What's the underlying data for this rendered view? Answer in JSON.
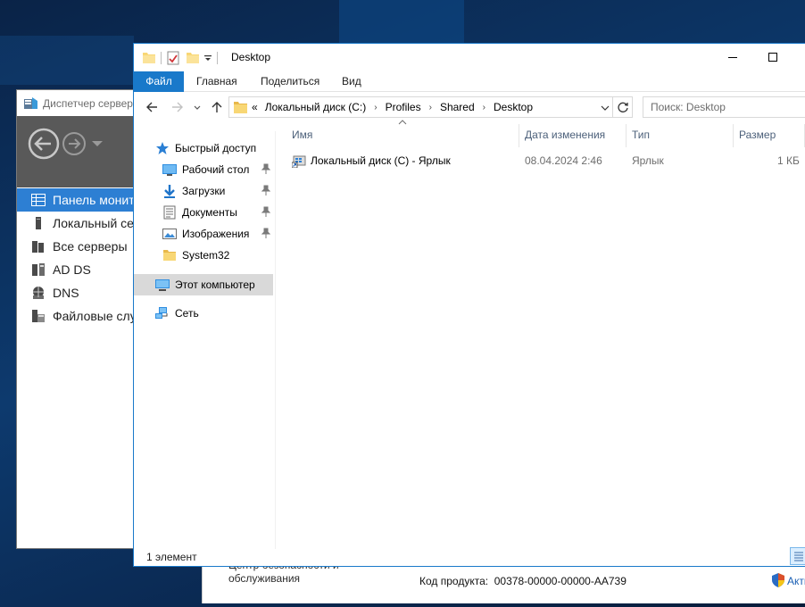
{
  "bottom_panel": {
    "security_link_line1": "Центр безопасности и",
    "security_link_line2": "обслуживания",
    "product_key_label": "Код продукта:",
    "product_key_value": "00378-00000-00000-AA739",
    "activate_text": "Акти"
  },
  "server_manager": {
    "title": "Диспетчер сервера",
    "items": [
      {
        "label": "Панель мониторинга",
        "icon": "dashboard-icon",
        "active": true
      },
      {
        "label": "Локальный сервер",
        "icon": "local-server-icon"
      },
      {
        "label": "Все серверы",
        "icon": "all-servers-icon"
      },
      {
        "label": "AD DS",
        "icon": "ad-ds-icon"
      },
      {
        "label": "DNS",
        "icon": "dns-icon"
      },
      {
        "label": "Файловые службы",
        "icon": "file-services-icon"
      }
    ]
  },
  "explorer": {
    "title": "Desktop",
    "ribbon_tabs": [
      "Файл",
      "Главная",
      "Поделиться",
      "Вид"
    ],
    "address": {
      "overflow": "«",
      "crumbs": [
        "Локальный диск (C:)",
        "Profiles",
        "Shared",
        "Desktop"
      ]
    },
    "search": {
      "placeholder": "Поиск: Desktop"
    },
    "nav": {
      "quick_access": "Быстрый доступ",
      "quick_items": [
        {
          "label": "Рабочий стол",
          "icon": "desktop-folder-icon",
          "pinned": true
        },
        {
          "label": "Загрузки",
          "icon": "downloads-icon",
          "pinned": true
        },
        {
          "label": "Документы",
          "icon": "documents-icon",
          "pinned": true
        },
        {
          "label": "Изображения",
          "icon": "pictures-icon",
          "pinned": true
        },
        {
          "label": "System32",
          "icon": "folder-icon",
          "pinned": false
        }
      ],
      "this_pc": "Этот компьютер",
      "network": "Сеть"
    },
    "columns": [
      "Имя",
      "Дата изменения",
      "Тип",
      "Размер"
    ],
    "files": [
      {
        "name": "Локальный диск (C) - Ярлык",
        "modified": "08.04.2024 2:46",
        "type": "Ярлык",
        "size": "1 КБ"
      }
    ],
    "status": "1 элемент"
  },
  "colors": {
    "accent": "#1979ca",
    "server_manager_active": "#2d7fd3",
    "server_manager_nav": "#595959"
  }
}
